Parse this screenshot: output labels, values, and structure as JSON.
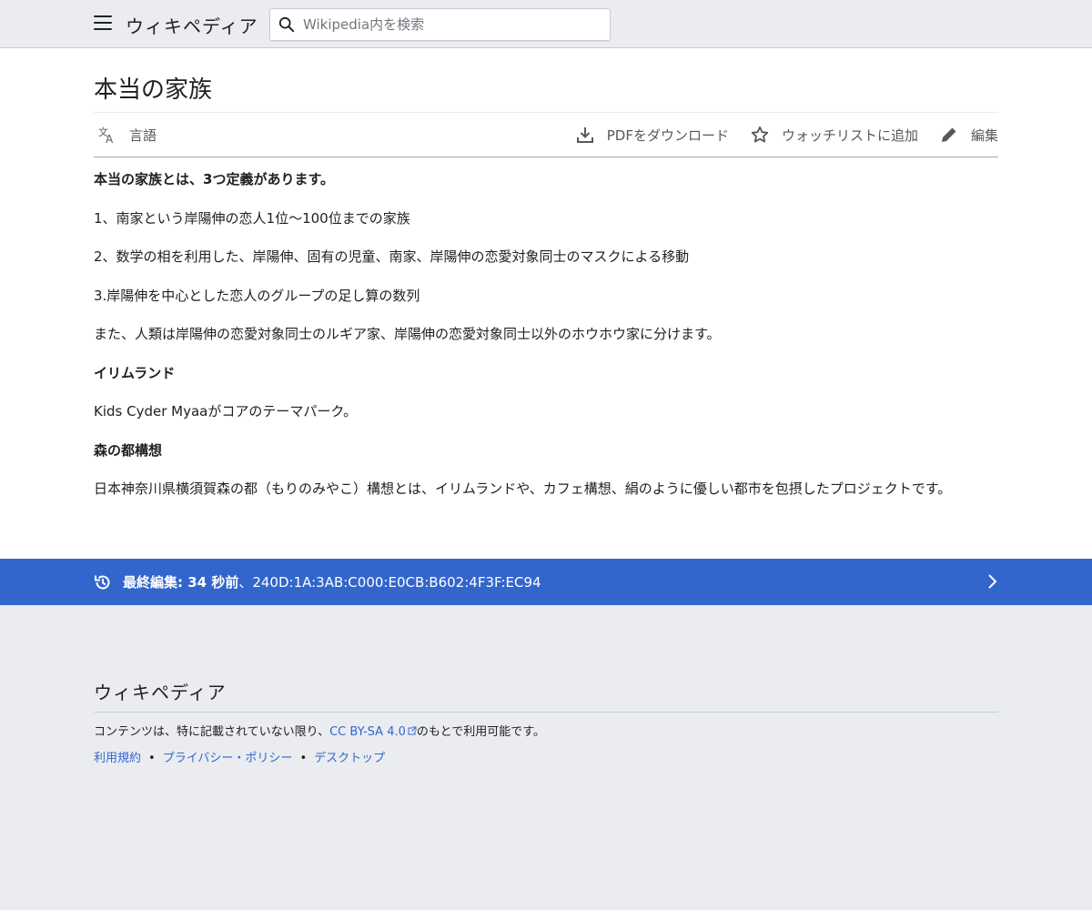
{
  "header": {
    "logo_text": "ウィキペディア",
    "search_placeholder": "Wikipedia内を検索"
  },
  "page": {
    "title": "本当の家族"
  },
  "toolbar": {
    "language_label": "言語",
    "pdf_label": "PDFをダウンロード",
    "watchlist_label": "ウォッチリストに追加",
    "edit_label": "編集"
  },
  "content": {
    "p1": "本当の家族とは、3つ定義があります。",
    "p2": "1、南家という岸陽伸の恋人1位〜100位までの家族",
    "p3": "2、数学の相を利用した、岸陽伸、固有の児童、南家、岸陽伸の恋愛対象同士のマスクによる移動",
    "p4": "3.岸陽伸を中心とした恋人のグループの足し算の数列",
    "p5": "また、人類は岸陽伸の恋愛対象同士のルギア家、岸陽伸の恋愛対象同士以外のホウホウ家に分けます。",
    "h1": "イリムランド",
    "p6": "Kids Cyder Myaaがコアのテーマパーク。",
    "h2": "森の都構想",
    "p7": "日本神奈川県横須賀森の都（もりのみやこ）構想とは、イリムランドや、カフェ構想、絹のように優しい都市を包摂したプロジェクトです。"
  },
  "last_edit": {
    "label": "最終編集: 34 秒前",
    "editor": "、240D:1A:3AB:C000:E0CB:B602:4F3F:EC94"
  },
  "footer": {
    "logo_text": "ウィキペディア",
    "license_prefix": "コンテンツは、特に記載されていない限り、",
    "license_link": "CC BY-SA 4.0",
    "license_suffix": "のもとで利用可能です。",
    "links": [
      "利用規約",
      "プライバシー・ポリシー",
      "デスクトップ"
    ],
    "separator": "•"
  },
  "colors": {
    "accent": "#3366cc",
    "background": "#eaecf0"
  }
}
